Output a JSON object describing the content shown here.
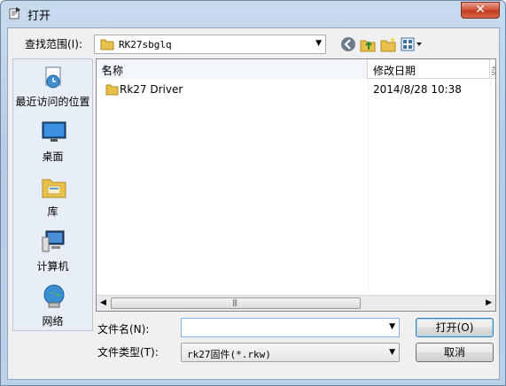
{
  "window": {
    "title": "打开",
    "close_label": "✕"
  },
  "toolbar": {
    "look_in_label": "查找范围(I):",
    "look_in_value": "RK27sbglq"
  },
  "places": [
    {
      "label": "最近访问的位置",
      "icon": "recent-places-icon"
    },
    {
      "label": "桌面",
      "icon": "desktop-icon"
    },
    {
      "label": "库",
      "icon": "libraries-icon"
    },
    {
      "label": "计算机",
      "icon": "computer-icon"
    },
    {
      "label": "网络",
      "icon": "network-icon"
    }
  ],
  "file_list": {
    "columns": [
      "名称",
      "修改日期",
      "类"
    ],
    "rows": [
      {
        "name": "Rk27 Driver",
        "modified": "2014/8/28 10:38"
      }
    ]
  },
  "file_name": {
    "label": "文件名(N):",
    "value": ""
  },
  "file_type": {
    "label": "文件类型(T):",
    "value": "rk27固件(*.rkw)"
  },
  "buttons": {
    "open": "打开(O)",
    "cancel": "取消"
  },
  "colors": {
    "close_red": "#c23a1e",
    "folder_yellow": "#e8c14a",
    "selection_blue": "#3c7fb1"
  }
}
